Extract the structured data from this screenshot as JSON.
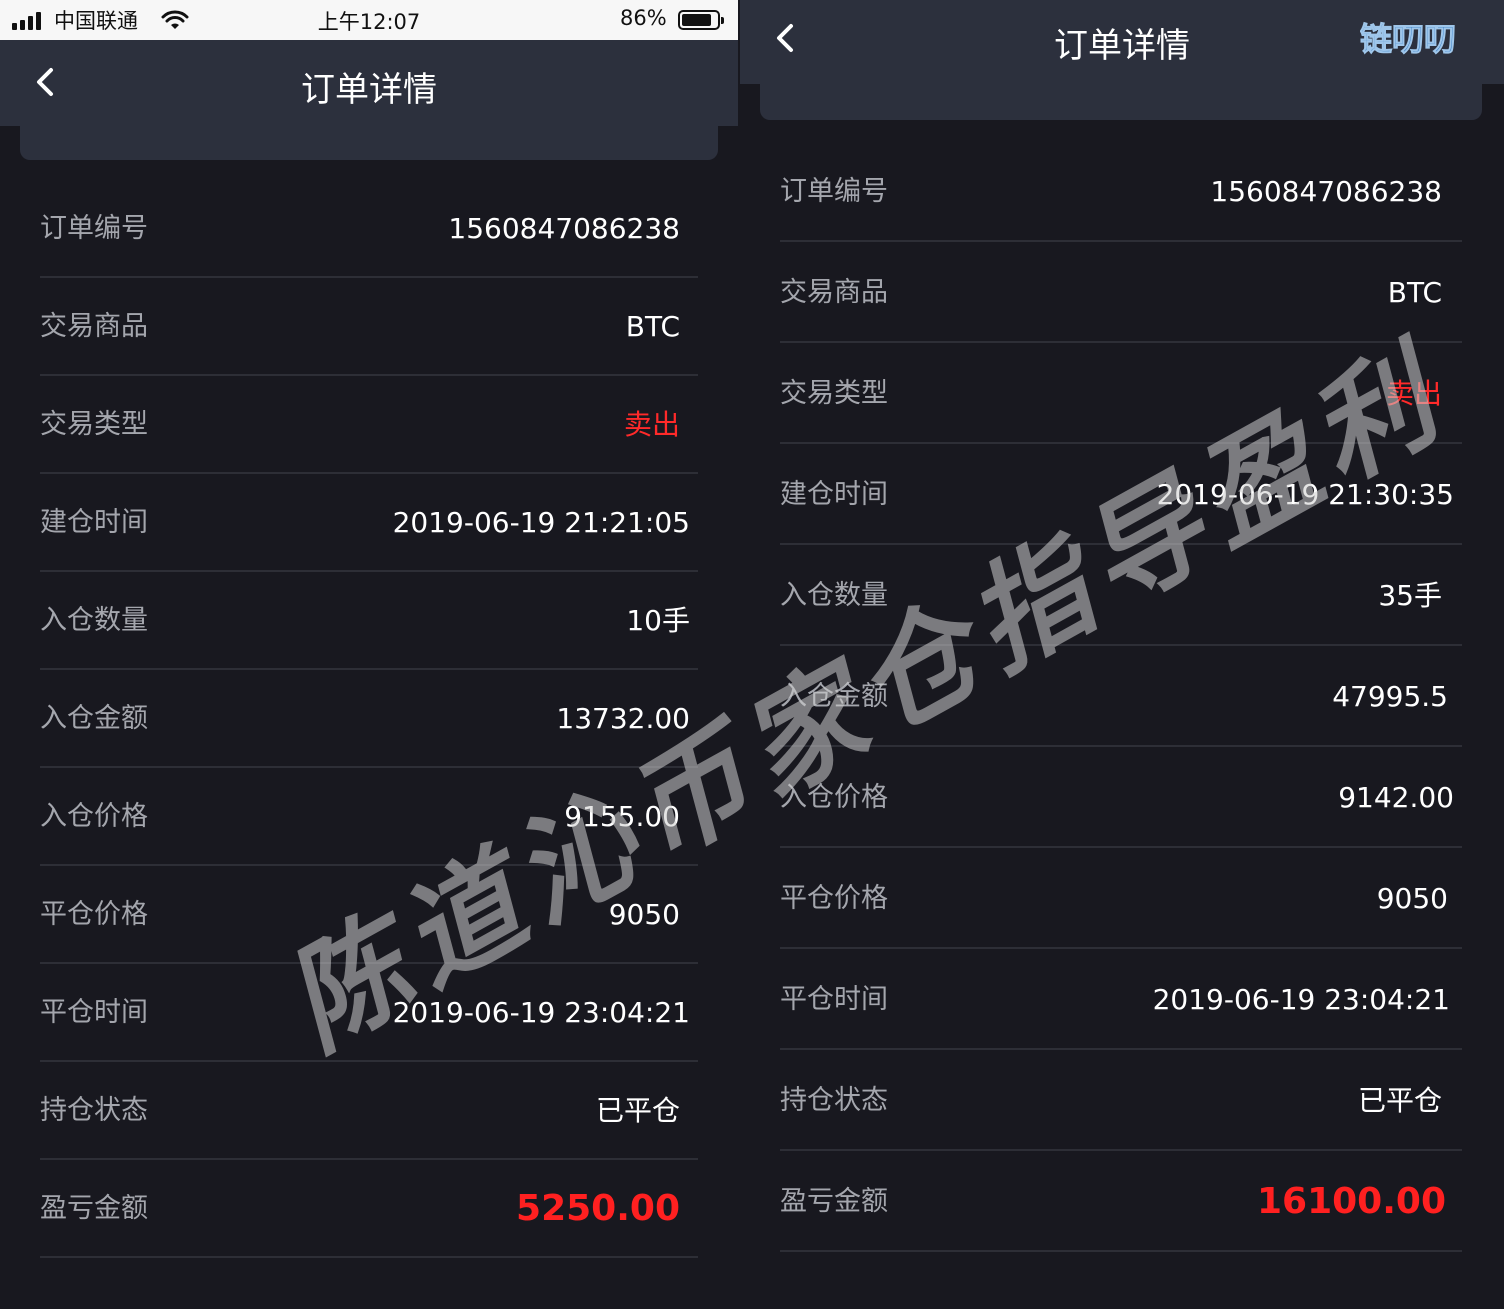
{
  "status_bar": {
    "carrier": "中国联通",
    "time": "上午12:07",
    "battery_percent": "86%",
    "battery_level": 0.86
  },
  "left": {
    "title": "订单详情",
    "rows": [
      {
        "label": "订单编号",
        "value": "1560847086238"
      },
      {
        "label": "交易商品",
        "value": "BTC"
      },
      {
        "label": "交易类型",
        "value": "卖出"
      },
      {
        "label": "建仓时间",
        "value": "2019-06-19 21:21:05"
      },
      {
        "label": "入仓数量",
        "value": "10手"
      },
      {
        "label": "入仓金额",
        "value": "13732.00"
      },
      {
        "label": "入仓价格",
        "value": "9155.00"
      },
      {
        "label": "平仓价格",
        "value": "9050"
      },
      {
        "label": "平仓时间",
        "value": "2019-06-19 23:04:21"
      },
      {
        "label": "持仓状态",
        "value": "已平仓"
      },
      {
        "label": "盈亏金额",
        "value": "5250.00"
      }
    ]
  },
  "right": {
    "title": "订单详情",
    "logo_text": "链叨叨",
    "rows": [
      {
        "label": "订单编号",
        "value": "1560847086238"
      },
      {
        "label": "交易商品",
        "value": "BTC"
      },
      {
        "label": "交易类型",
        "value": "卖出"
      },
      {
        "label": "建仓时间",
        "value": "2019-06-19 21:30:35"
      },
      {
        "label": "入仓数量",
        "value": "35手"
      },
      {
        "label": "入仓金额",
        "value": "47995.5"
      },
      {
        "label": "入仓价格",
        "value": "9142.00"
      },
      {
        "label": "平仓价格",
        "value": "9050"
      },
      {
        "label": "平仓时间",
        "value": "2019-06-19 23:04:21"
      },
      {
        "label": "持仓状态",
        "value": "已平仓"
      },
      {
        "label": "盈亏金额",
        "value": "16100.00"
      }
    ]
  },
  "watermark": "陈道沁币家仓指导盈利",
  "colors": {
    "background": "#18181f",
    "header": "#2c303d",
    "label": "#a4a6ad",
    "sell": "#ff2a2a",
    "profit": "#ff2020"
  },
  "icons": {
    "back": "chevron-left-icon",
    "signal": "signal-bars-icon",
    "wifi": "wifi-icon",
    "battery": "battery-icon"
  }
}
